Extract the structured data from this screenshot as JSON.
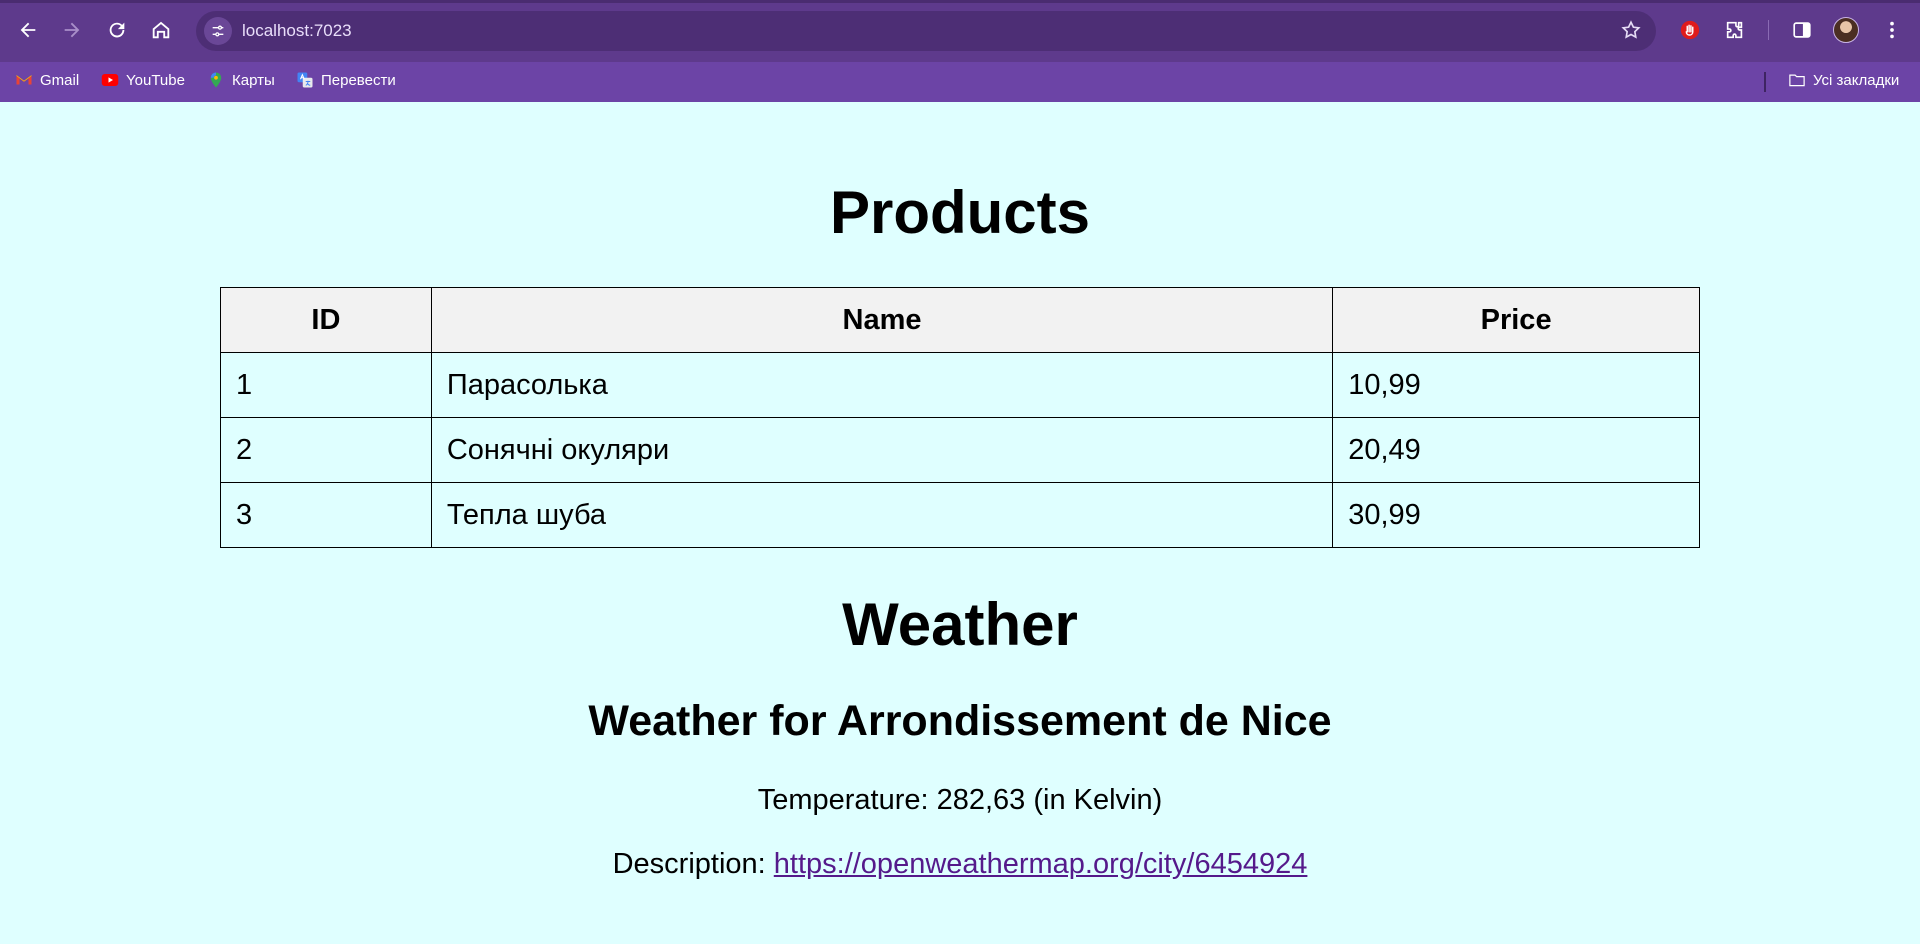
{
  "browser": {
    "url": "localhost:7023",
    "bookmarks": [
      {
        "label": "Gmail",
        "icon": "gmail-icon"
      },
      {
        "label": "YouTube",
        "icon": "youtube-icon"
      },
      {
        "label": "Карты",
        "icon": "maps-icon"
      },
      {
        "label": "Перевести",
        "icon": "translate-icon"
      }
    ],
    "all_bookmarks_label": "Усі закладки",
    "theme_color": "#6c44a6"
  },
  "products": {
    "title": "Products",
    "columns": [
      "ID",
      "Name",
      "Price"
    ],
    "rows": [
      {
        "id": "1",
        "name": "Парасолька",
        "price": "10,99"
      },
      {
        "id": "2",
        "name": "Сонячні окуляри",
        "price": "20,49"
      },
      {
        "id": "3",
        "name": "Тепла шуба",
        "price": "30,99"
      }
    ]
  },
  "weather": {
    "title": "Weather",
    "city_heading": "Weather for Arrondissement de Nice",
    "temperature_line": "Temperature: 282,63 (in Kelvin)",
    "description_label": "Description: ",
    "description_link": "https://openweathermap.org/city/6454924"
  }
}
